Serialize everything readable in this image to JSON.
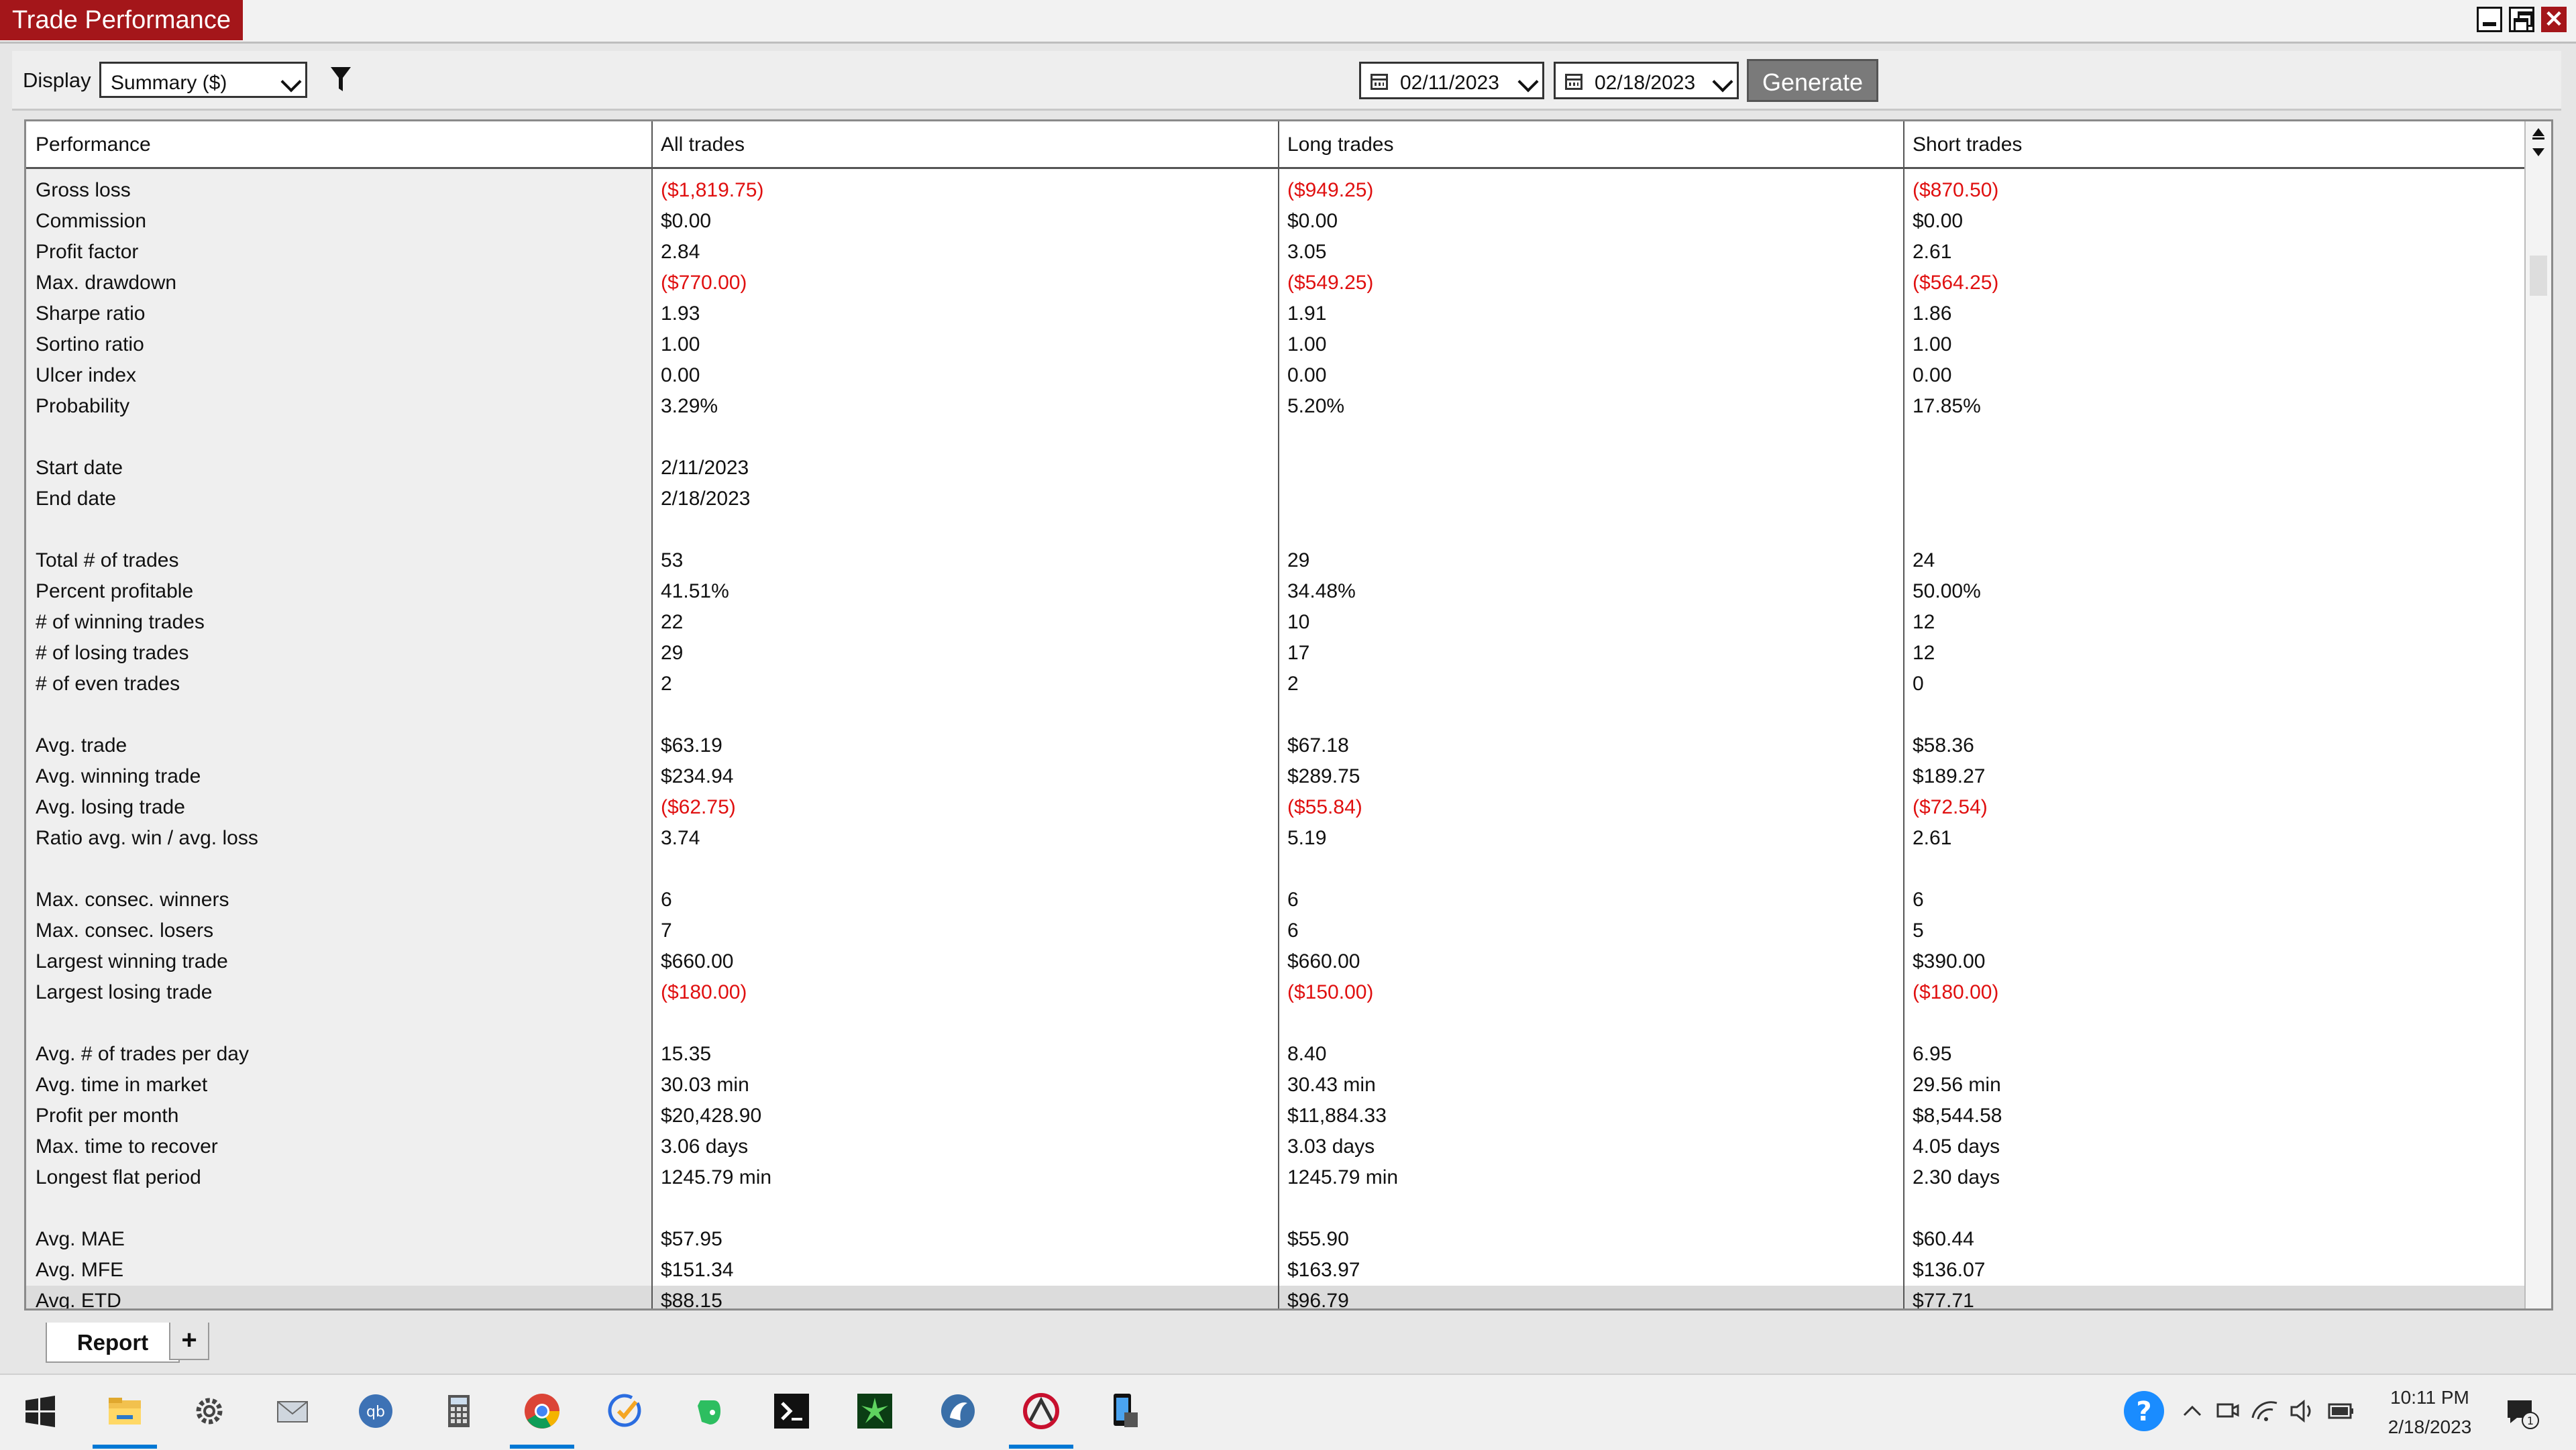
{
  "window": {
    "title": "Trade Performance",
    "close_glyph": "✕"
  },
  "toolbar": {
    "display_label": "Display",
    "display_value": "Summary ($)",
    "start_date": "02/11/2023",
    "end_date": "02/18/2023",
    "generate_label": "Generate"
  },
  "table": {
    "headers": [
      "Performance",
      "All trades",
      "Long trades",
      "Short trades"
    ],
    "rows": [
      {
        "label": "Gross loss",
        "all": "($1,819.75)",
        "long": "($949.25)",
        "short": "($870.50)",
        "neg": true
      },
      {
        "label": "Commission",
        "all": "$0.00",
        "long": "$0.00",
        "short": "$0.00"
      },
      {
        "label": "Profit factor",
        "all": "2.84",
        "long": "3.05",
        "short": "2.61"
      },
      {
        "label": "Max. drawdown",
        "all": "($770.00)",
        "long": "($549.25)",
        "short": "($564.25)",
        "neg": true
      },
      {
        "label": "Sharpe ratio",
        "all": "1.93",
        "long": "1.91",
        "short": "1.86"
      },
      {
        "label": "Sortino ratio",
        "all": "1.00",
        "long": "1.00",
        "short": "1.00"
      },
      {
        "label": "Ulcer index",
        "all": "0.00",
        "long": "0.00",
        "short": "0.00"
      },
      {
        "label": "Probability",
        "all": "3.29%",
        "long": "5.20%",
        "short": "17.85%"
      },
      {
        "label": "",
        "all": "",
        "long": "",
        "short": ""
      },
      {
        "label": "Start date",
        "all": "2/11/2023",
        "long": "",
        "short": ""
      },
      {
        "label": "End date",
        "all": "2/18/2023",
        "long": "",
        "short": ""
      },
      {
        "label": "",
        "all": "",
        "long": "",
        "short": ""
      },
      {
        "label": "Total # of trades",
        "all": "53",
        "long": "29",
        "short": "24"
      },
      {
        "label": "Percent profitable",
        "all": "41.51%",
        "long": "34.48%",
        "short": "50.00%"
      },
      {
        "label": "# of winning trades",
        "all": "22",
        "long": "10",
        "short": "12"
      },
      {
        "label": "# of losing trades",
        "all": "29",
        "long": "17",
        "short": "12"
      },
      {
        "label": "# of even trades",
        "all": "2",
        "long": "2",
        "short": "0"
      },
      {
        "label": "",
        "all": "",
        "long": "",
        "short": ""
      },
      {
        "label": "Avg. trade",
        "all": "$63.19",
        "long": "$67.18",
        "short": "$58.36"
      },
      {
        "label": "Avg. winning trade",
        "all": "$234.94",
        "long": "$289.75",
        "short": "$189.27"
      },
      {
        "label": "Avg. losing trade",
        "all": "($62.75)",
        "long": "($55.84)",
        "short": "($72.54)",
        "neg": true
      },
      {
        "label": "Ratio avg. win / avg. loss",
        "all": "3.74",
        "long": "5.19",
        "short": "2.61"
      },
      {
        "label": "",
        "all": "",
        "long": "",
        "short": ""
      },
      {
        "label": "Max. consec. winners",
        "all": "6",
        "long": "6",
        "short": "6"
      },
      {
        "label": "Max. consec. losers",
        "all": "7",
        "long": "6",
        "short": "5"
      },
      {
        "label": "Largest winning trade",
        "all": "$660.00",
        "long": "$660.00",
        "short": "$390.00"
      },
      {
        "label": "Largest losing trade",
        "all": "($180.00)",
        "long": "($150.00)",
        "short": "($180.00)",
        "neg": true
      },
      {
        "label": "",
        "all": "",
        "long": "",
        "short": ""
      },
      {
        "label": "Avg. # of trades per day",
        "all": "15.35",
        "long": "8.40",
        "short": "6.95"
      },
      {
        "label": "Avg. time in market",
        "all": "30.03 min",
        "long": "30.43 min",
        "short": "29.56 min"
      },
      {
        "label": "Profit per month",
        "all": "$20,428.90",
        "long": "$11,884.33",
        "short": "$8,544.58"
      },
      {
        "label": "Max. time to recover",
        "all": "3.06 days",
        "long": "3.03 days",
        "short": "4.05 days"
      },
      {
        "label": "Longest flat period",
        "all": "1245.79 min",
        "long": "1245.79 min",
        "short": "2.30 days"
      },
      {
        "label": "",
        "all": "",
        "long": "",
        "short": ""
      },
      {
        "label": "Avg. MAE",
        "all": "$57.95",
        "long": "$55.90",
        "short": "$60.44"
      },
      {
        "label": "Avg. MFE",
        "all": "$151.34",
        "long": "$163.97",
        "short": "$136.07"
      },
      {
        "label": "Avg. ETD",
        "all": "$88.15",
        "long": "$96.79",
        "short": "$77.71",
        "highlight": true
      }
    ]
  },
  "tabs": {
    "report_label": "Report",
    "add_label": "+"
  },
  "taskbar": {
    "icons": [
      "windows-start-icon",
      "file-explorer-icon",
      "settings-icon",
      "mail-icon",
      "qbittorrent-icon",
      "calculator-icon",
      "chrome-icon",
      "tasks-icon",
      "evernote-icon",
      "terminal-icon",
      "green-app-icon",
      "browser-icon",
      "trading-app-icon",
      "phone-link-icon"
    ],
    "time": "10:11 PM",
    "date": "2/18/2023",
    "notification_count": "1",
    "colors": {
      "accent": "#0078d4",
      "title_red": "#a4161a",
      "negative": "#e01010"
    }
  }
}
